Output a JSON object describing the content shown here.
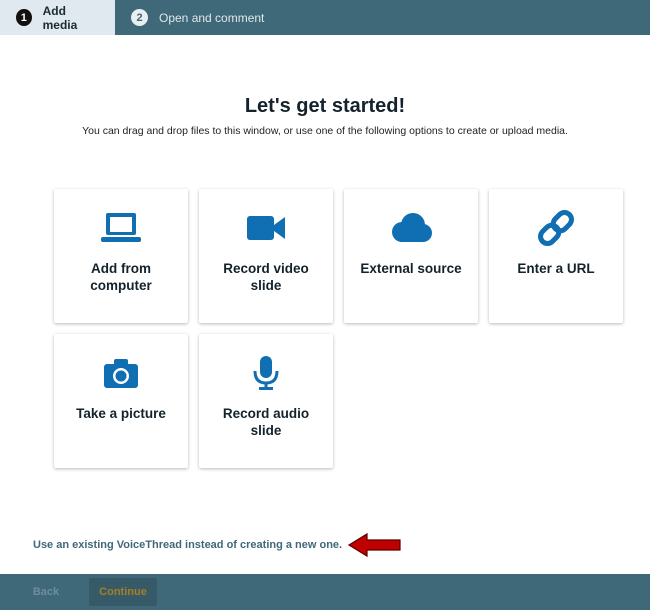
{
  "steps": [
    {
      "number": "1",
      "label": "Add media"
    },
    {
      "number": "2",
      "label": "Open and comment"
    }
  ],
  "heading": {
    "title": "Let's get started!",
    "subtitle": "You can drag and drop files to this window, or use one of the following options to create or upload media."
  },
  "options": [
    {
      "label": "Add from computer",
      "icon": "laptop-icon"
    },
    {
      "label": "Record video slide",
      "icon": "video-camera-icon"
    },
    {
      "label": "External source",
      "icon": "cloud-icon"
    },
    {
      "label": "Enter a URL",
      "icon": "link-icon"
    },
    {
      "label": "Take a picture",
      "icon": "camera-icon"
    },
    {
      "label": "Record audio slide",
      "icon": "microphone-icon"
    }
  ],
  "existing_link": "Use an existing VoiceThread instead of creating a new one.",
  "footer": {
    "back_label": "Back",
    "continue_label": "Continue"
  },
  "colors": {
    "primary": "#3f6878",
    "icon_blue": "#0f6fb2",
    "arrow_red": "#c00000",
    "continue_text": "#a57f23"
  }
}
